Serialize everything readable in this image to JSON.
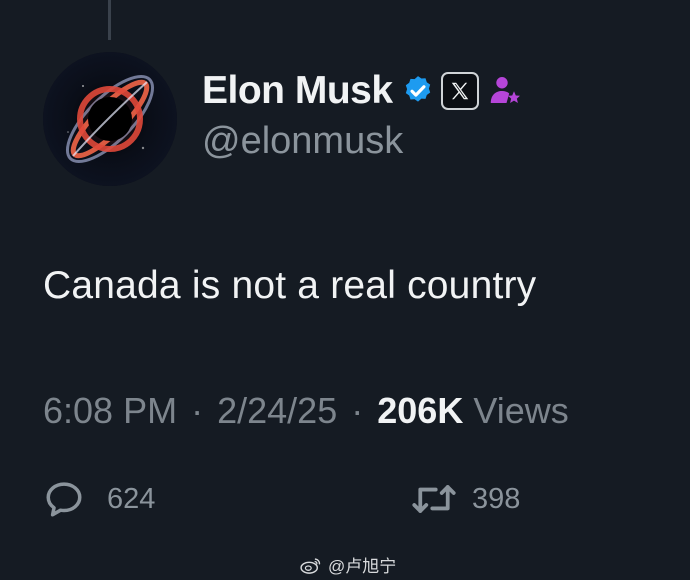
{
  "author": {
    "display_name": "Elon Musk",
    "handle": "@elonmusk",
    "verified_badge": "verified-check-icon",
    "affiliate_badge": "x-logo-icon",
    "affiliation_icon": "person-star-icon",
    "colors": {
      "verified": "#1d9bf0",
      "affiliation": "#b545d8"
    }
  },
  "tweet": {
    "text": "Canada is not a real country"
  },
  "meta": {
    "time": "6:08 PM",
    "separator": "·",
    "date": "2/24/25",
    "views_count": "206K",
    "views_label": "Views"
  },
  "actions": {
    "reply_count": "624",
    "retweet_count": "398"
  },
  "watermark": {
    "text": "@卢旭宁"
  }
}
